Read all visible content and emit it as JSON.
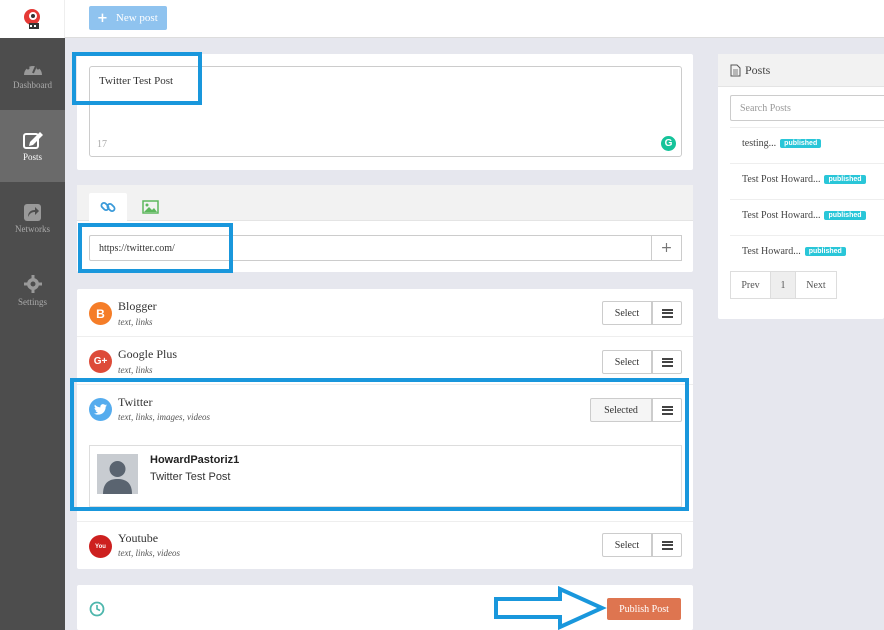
{
  "sidebar": {
    "items": [
      {
        "label": "Dashboard",
        "icon": "dashboard-icon"
      },
      {
        "label": "Posts",
        "icon": "edit-icon"
      },
      {
        "label": "Networks",
        "icon": "share-icon"
      },
      {
        "label": "Settings",
        "icon": "gear-icon"
      }
    ]
  },
  "topbar": {
    "new_post_label": "New post"
  },
  "editor": {
    "text": "Twitter Test Post",
    "char_count": "17"
  },
  "link": {
    "value": "https://twitter.com/"
  },
  "networks": [
    {
      "name": "Blogger",
      "caps": "text, links",
      "button": "Select",
      "color": "#f57d28",
      "icon_text": "B"
    },
    {
      "name": "Google Plus",
      "caps": "text, links",
      "button": "Select",
      "color": "#dd4b39",
      "icon_text": "G+"
    },
    {
      "name": "Twitter",
      "caps": "text, links, images, videos",
      "button": "Selected",
      "color": "#55acee",
      "icon_text": ""
    },
    {
      "name": "Youtube",
      "caps": "text, links, videos",
      "button": "Select",
      "color": "#cd201f",
      "icon_text": "You"
    }
  ],
  "preview": {
    "username": "HowardPastoriz1",
    "text": "Twitter Test Post"
  },
  "publish": {
    "label": "Publish Post"
  },
  "posts_panel": {
    "title": "Posts",
    "search_placeholder": "Search Posts",
    "items": [
      {
        "title": "testing...",
        "status": "published"
      },
      {
        "title": "Test Post Howard...",
        "status": "published"
      },
      {
        "title": "Test Post Howard...",
        "status": "published"
      },
      {
        "title": "Test Howard...",
        "status": "published"
      }
    ],
    "pager": {
      "prev": "Prev",
      "page": "1",
      "next": "Next"
    }
  },
  "colors": {
    "accent": "#1997dc",
    "publish": "#de7550",
    "badge": "#29c6d8",
    "sidebar": "#4d4d4d"
  }
}
